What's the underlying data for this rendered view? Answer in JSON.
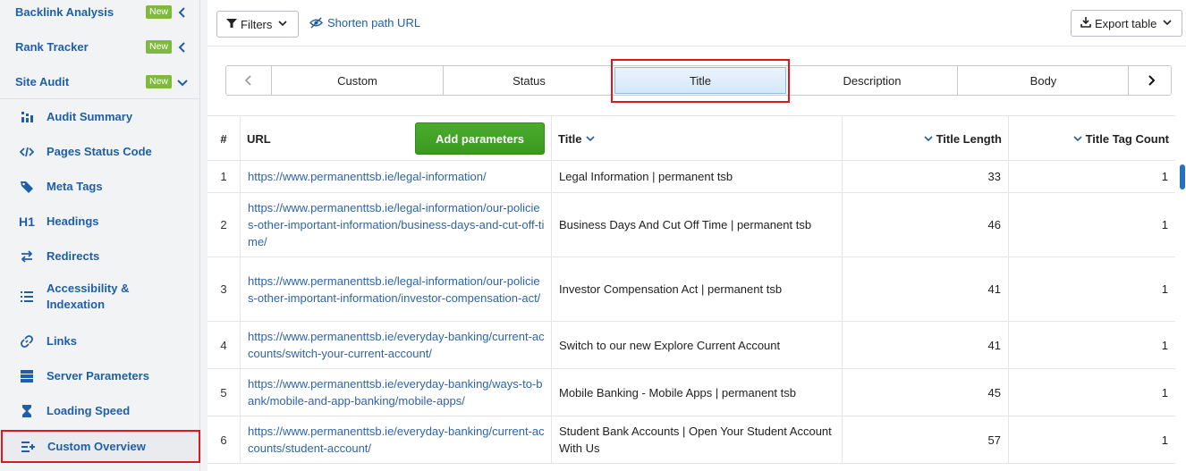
{
  "sidebar": {
    "top_items": [
      {
        "label": "Backlink Analysis",
        "badge": "New",
        "chevron": "chevron-left-icon"
      },
      {
        "label": "Rank Tracker",
        "badge": "New",
        "chevron": "chevron-left-icon"
      },
      {
        "label": "Site Audit",
        "badge": "New",
        "chevron": "chevron-down-icon"
      }
    ],
    "sub_items": [
      {
        "label": "Audit Summary",
        "icon": "audit-summary-icon"
      },
      {
        "label": "Pages Status Code",
        "icon": "code-icon"
      },
      {
        "label": "Meta Tags",
        "icon": "tag-icon"
      },
      {
        "label": "Headings",
        "icon": "h1-icon",
        "icon_text": "H1"
      },
      {
        "label": "Redirects",
        "icon": "redirect-arrows-icon"
      },
      {
        "label": "Accessibility &",
        "label2": "Indexation",
        "icon": "list-icon"
      },
      {
        "label": "Links",
        "icon": "link-icon"
      },
      {
        "label": "Server Parameters",
        "icon": "server-icon"
      },
      {
        "label": "Loading Speed",
        "icon": "hourglass-icon"
      },
      {
        "label": "Custom Overview",
        "icon": "custom-list-plus-icon",
        "active": true
      }
    ]
  },
  "toolbar": {
    "filters_label": "Filters",
    "shorten_label": "Shorten path URL",
    "export_label": "Export table"
  },
  "tabs": {
    "items": [
      "Custom",
      "Status",
      "Title",
      "Description",
      "Body"
    ],
    "selected": "Title"
  },
  "table": {
    "headers": {
      "index": "#",
      "url": "URL",
      "add_params": "Add parameters",
      "title": "Title",
      "title_length": "Title Length",
      "title_tag_count": "Title Tag Count"
    },
    "rows": [
      {
        "n": "1",
        "url": "https://www.permanenttsb.ie/legal-information/",
        "title": "Legal Information | permanent tsb",
        "len": "33",
        "count": "1"
      },
      {
        "n": "2",
        "url": "https://www.permanenttsb.ie/legal-information/our-policies-other-important-information/business-days-and-cut-off-time/",
        "title": "Business Days And Cut Off Time | permanent tsb",
        "len": "46",
        "count": "1"
      },
      {
        "n": "3",
        "url": "https://www.permanenttsb.ie/legal-information/our-policies-other-important-information/investor-compensation-act/",
        "title": "Investor Compensation Act | permanent tsb",
        "len": "41",
        "count": "1"
      },
      {
        "n": "4",
        "url": "https://www.permanenttsb.ie/everyday-banking/current-accounts/switch-your-current-account/",
        "title": "Switch to our new Explore Current Account",
        "len": "41",
        "count": "1"
      },
      {
        "n": "5",
        "url": "https://www.permanenttsb.ie/everyday-banking/ways-to-bank/mobile-and-app-banking/mobile-apps/",
        "title": "Mobile Banking - Mobile Apps | permanent tsb",
        "len": "45",
        "count": "1"
      },
      {
        "n": "6",
        "url": "https://www.permanenttsb.ie/everyday-banking/current-accounts/student-account/",
        "title": "Student Bank Accounts | Open Your Student Account With Us",
        "len": "57",
        "count": "1"
      }
    ]
  },
  "colors": {
    "link": "#1f5fa8",
    "badge_green": "#7fba3f",
    "button_green": "#3a9a1f",
    "highlight_red": "#d9191c"
  }
}
